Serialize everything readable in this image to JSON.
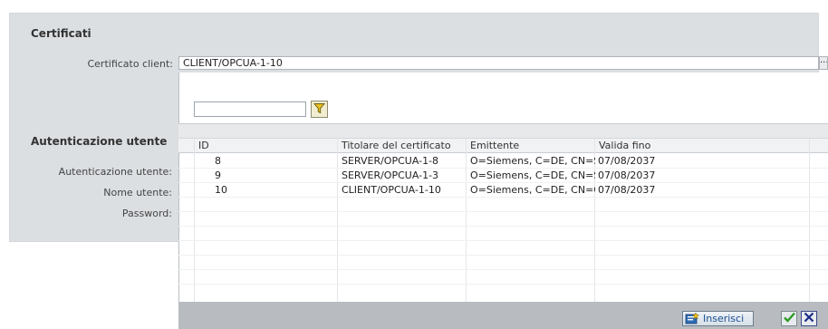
{
  "sections": {
    "certificates_title": "Certificati",
    "auth_title": "Autenticazione utente"
  },
  "fields": {
    "client_cert_label": "Certificato client:",
    "client_cert_value": "CLIENT/OPCUA-1-10",
    "browse_label": "...",
    "auth_label": "Autenticazione utente:",
    "username_label": "Nome utente:",
    "password_label": "Password:"
  },
  "filter": {
    "value": "",
    "icon": "filter-icon"
  },
  "table": {
    "columns": [
      "ID",
      "Titolare del certificato",
      "Emittente",
      "Valida fino"
    ],
    "rows": [
      {
        "id": "8",
        "owner": "SERVER/OPCUA-1-8",
        "issuer": "O=Siemens, C=DE, CN=S.",
        "valid": "07/08/2037"
      },
      {
        "id": "9",
        "owner": "SERVER/OPCUA-1-3",
        "issuer": "O=Siemens, C=DE, CN=S.",
        "valid": "07/08/2037"
      },
      {
        "id": "10",
        "owner": "CLIENT/OPCUA-1-10",
        "issuer": "O=Siemens, C=DE, CN=C.",
        "valid": "07/08/2037"
      }
    ]
  },
  "footer": {
    "insert_label": "Inserisci",
    "insert_icon": "insert-certificate-icon",
    "confirm_icon": "check-icon",
    "cancel_icon": "close-icon"
  }
}
